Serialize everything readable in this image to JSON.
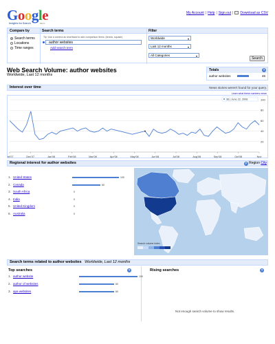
{
  "header": {
    "logo_text": "Google",
    "logo_sub": "Insights for Search",
    "logo_beta": "BETA",
    "links": [
      "My Account",
      "Help",
      "Sign out"
    ],
    "csv_label": "Download as CSV"
  },
  "compare": {
    "compare_by_label": "Compare by",
    "search_terms_label": "Search terms",
    "filter_label": "Filter",
    "options": [
      "Search terms",
      "Locations",
      "Time ranges"
    ],
    "selected_option": "Search terms",
    "tip": "Tip: Use a comma as shorthand to add comparison items. (tennis, squash)",
    "term_value": "author websites",
    "add_term": "Add search term",
    "location_select": "Worldwide",
    "time_select": "Last 12 months",
    "category_select": "All Categories",
    "search_button": "Search"
  },
  "title": {
    "main": "Web Search Volume: author websites",
    "sub": "Worldwide, Last 12 months"
  },
  "totals": {
    "heading": "Totals",
    "term": "author websites",
    "value": "46",
    "fraction": 0.46
  },
  "interest": {
    "heading": "Interest over time",
    "news_note": "News stories weren't found for your query.",
    "learn_more": "Learn what these numbers mean",
    "tooltip": "36 | June 22, 2008"
  },
  "chart_data": {
    "type": "line",
    "x_ticks": [
      "Oct'07",
      "Dec'07",
      "Jan'08",
      "Feb'08",
      "Mar'08",
      "Apr'08",
      "May'08",
      "Jun'08",
      "Jul'08",
      "Aug'08",
      "Sep'08",
      "Oct'08",
      "Nov"
    ],
    "y_ticks": [
      20,
      40,
      60,
      80,
      100
    ],
    "ylim": [
      0,
      100
    ],
    "series": [
      {
        "values": [
          60,
          52,
          44,
          38,
          52,
          78,
          34,
          24,
          26,
          34,
          38,
          34,
          40,
          42,
          44,
          46,
          40,
          44,
          46,
          40,
          38,
          40,
          46,
          40,
          44,
          42,
          40,
          38,
          36,
          34,
          36,
          38,
          40,
          30,
          44,
          38,
          36,
          38,
          44,
          40,
          34,
          36,
          32,
          38,
          36,
          44,
          32,
          30,
          40,
          48,
          42,
          36,
          38,
          44,
          56,
          48,
          44,
          54,
          60,
          52
        ]
      }
    ],
    "color": "#4b7fd4"
  },
  "regional": {
    "heading": "Regional interest  for author websites",
    "region_link": "Region",
    "city_link": "City",
    "items": [
      {
        "rank": "1.",
        "name": "United States",
        "value": 100
      },
      {
        "rank": "2.",
        "name": "Canada",
        "value": 60
      },
      {
        "rank": "3.",
        "name": "South Africa",
        "value": 0
      },
      {
        "rank": "4.",
        "name": "India",
        "value": 0
      },
      {
        "rank": "5.",
        "name": "United Kingdom",
        "value": 0
      },
      {
        "rank": "6.",
        "name": "Australia",
        "value": 0
      }
    ],
    "legend_label": "Search volume index",
    "legend_colors": [
      "#eaf1fb",
      "#c6d9f3",
      "#8fb3e6",
      "#4f7fd0",
      "#2a52b5",
      "#123a8f"
    ]
  },
  "related": {
    "heading": "Search terms related to author websites",
    "heading_sub": "Worldwide, Last 12 months",
    "top_label": "Top searches",
    "rising_label": "Rising searches",
    "top_items": [
      {
        "rank": "1.",
        "name": "author website",
        "value": 100
      },
      {
        "rank": "2.",
        "name": "author of websites",
        "value": 60
      },
      {
        "rank": "3.",
        "name": "apa websites",
        "value": 60
      }
    ],
    "rising_empty": "Not enough search volume to show results."
  }
}
